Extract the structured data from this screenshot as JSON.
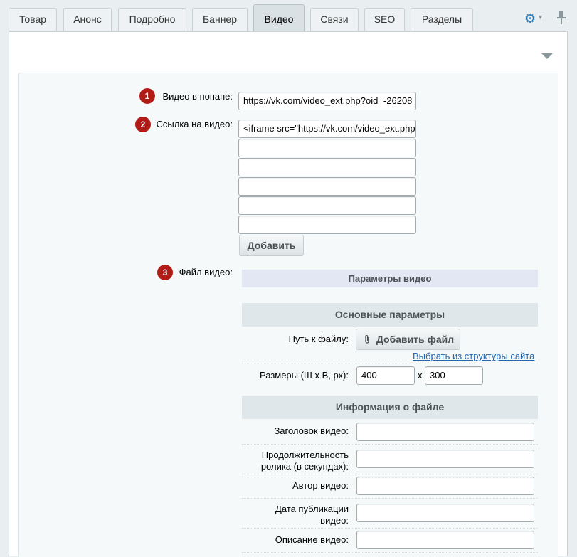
{
  "tabs": [
    "Товар",
    "Анонс",
    "Подробно",
    "Баннер",
    "Видео",
    "Связи",
    "SEO",
    "Разделы"
  ],
  "active_tab": "Видео",
  "tools": {
    "settings_icon": "gear-icon",
    "pin_icon": "pin-icon"
  },
  "form": {
    "popup_video": {
      "badge": "1",
      "label": "Видео в попапе:",
      "value": "https://vk.com/video_ext.php?oid=-26208"
    },
    "video_link": {
      "badge": "2",
      "label": "Ссылка на видео:",
      "values": [
        "<iframe src=\"https://vk.com/video_ext.php",
        "",
        "",
        "",
        ""
      ],
      "add_button": "Добавить"
    },
    "video_file": {
      "badge": "3",
      "label": "Файл видео:"
    }
  },
  "video_params": {
    "title": "Параметры видео",
    "basic_section": "Основные параметры",
    "file_path_label": "Путь к файлу:",
    "add_file_button": "Добавить файл",
    "choose_from_site_link": "Выбрать из структуры сайта",
    "size_label": "Размеры (Ш х В, рх):",
    "width": "400",
    "x_sep": "x",
    "height": "300",
    "file_info_section": "Информация о файле",
    "fields": [
      {
        "label": "Заголовок видео:",
        "value": ""
      },
      {
        "label": "Продолжительность ролика (в секундах):",
        "value": ""
      },
      {
        "label": "Автор видео:",
        "value": ""
      },
      {
        "label": "Дата публикации видео:",
        "value": ""
      },
      {
        "label": "Описание видео:",
        "value": ""
      }
    ]
  }
}
